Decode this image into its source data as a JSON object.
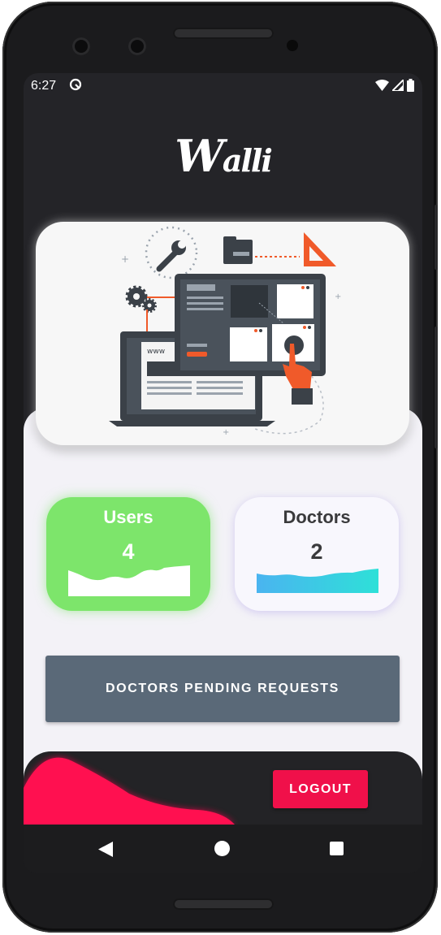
{
  "status_bar": {
    "time": "6:27"
  },
  "app": {
    "logo_main": "W",
    "logo_rest": "alli"
  },
  "stats": {
    "users": {
      "label": "Users",
      "value": "4"
    },
    "doctors": {
      "label": "Doctors",
      "value": "2"
    }
  },
  "actions": {
    "pending_label": "DOCTORS PENDING REQUESTS",
    "logout_label": "LOGOUT"
  },
  "illustration": {
    "browser_text": "www"
  },
  "colors": {
    "screen_bg": "#242428",
    "content_bg": "#f3f2f7",
    "users_card": "#7de56b",
    "doctors_wave_start": "#4ab4f0",
    "doctors_wave_end": "#2ee0d8",
    "pending_button": "#5a6978",
    "logout_button": "#f0104a",
    "accent_orange": "#f05a2a"
  },
  "icons": [
    "settings-status-icon",
    "wifi-icon",
    "signal-icon",
    "battery-icon",
    "back-icon",
    "home-icon",
    "recents-icon"
  ]
}
